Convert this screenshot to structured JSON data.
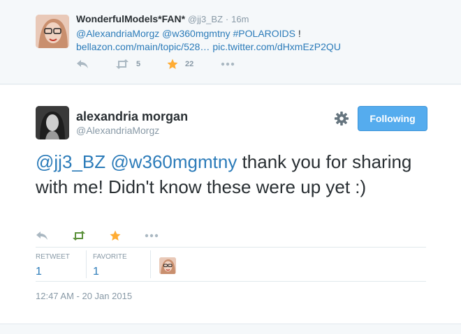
{
  "top_tweet": {
    "name": "WonderfulModels*FAN*",
    "handle": "@jj3_BZ",
    "dot": "·",
    "time": "16m",
    "mention1": "@AlexandriaMorgz",
    "mention2": "@w360mgmtny",
    "hashtag": "#POLAROIDS",
    "bang": "!",
    "link1": "bellazon.com/main/topic/528…",
    "link2": "pic.twitter.com/dHxmEzP2QU",
    "retweet_count": "5",
    "favorite_count": "22"
  },
  "main_tweet": {
    "name": "alexandria morgan",
    "handle": "@AlexandriaMorgz",
    "follow_label": "Following",
    "mention1": "@jj3_BZ",
    "mention2": "@w360mgmtny",
    "text": "thank you for sharing with me! Didn't know these were up yet :)",
    "stats": {
      "retweet_label": "RETWEET",
      "retweet_value": "1",
      "favorite_label": "FAVORITE",
      "favorite_value": "1"
    },
    "timestamp": "12:47 AM - 20 Jan 2015"
  },
  "colors": {
    "link": "#2b7bb9",
    "follow_button": "#55acee",
    "retweet_active": "#5c913b",
    "favorite_active": "#ffac33",
    "muted": "#8899a6"
  },
  "icons": [
    "reply-icon",
    "retweet-icon",
    "favorite-icon",
    "more-icon",
    "gear-icon"
  ]
}
